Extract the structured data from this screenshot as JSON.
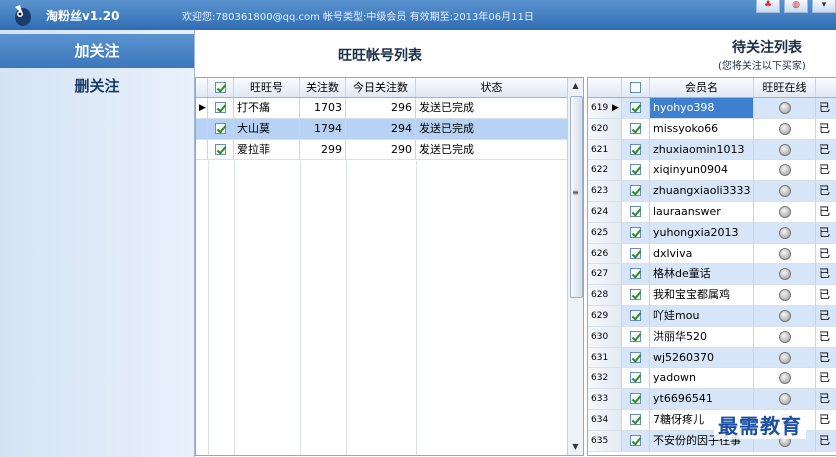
{
  "app": {
    "title": "淘粉丝v1.20",
    "welcome": "欢迎您:780361800@qq.com  帐号类型:中级会员  有效期至:2013年06月11日"
  },
  "sidebar": {
    "items": [
      {
        "label": "加关注",
        "active": true
      },
      {
        "label": "删关注",
        "active": false
      }
    ]
  },
  "left_panel": {
    "title": "旺旺帐号列表",
    "columns": [
      "旺旺号",
      "关注数",
      "今日关注数",
      "状态"
    ],
    "rows": [
      {
        "account": "打不痛",
        "follows": "1703",
        "today": "296",
        "status": "发送已完成",
        "checked": true,
        "current": true,
        "selected": false
      },
      {
        "account": "大山莫",
        "follows": "1794",
        "today": "294",
        "status": "发送已完成",
        "checked": true,
        "current": false,
        "selected": true
      },
      {
        "account": "爱拉菲",
        "follows": "299",
        "today": "290",
        "status": "发送已完成",
        "checked": true,
        "current": false,
        "selected": false
      }
    ]
  },
  "right_panel": {
    "title": "待关注列表",
    "subtitle": "(您将关注以下买家)",
    "columns": [
      "会员名",
      "旺旺在线"
    ],
    "status_text": "已",
    "rows": [
      {
        "num": "619",
        "name": "hyohyo398",
        "selected": true,
        "current": true
      },
      {
        "num": "620",
        "name": "missyoko66",
        "selected": false
      },
      {
        "num": "621",
        "name": "zhuxiaomin1013",
        "selected": true
      },
      {
        "num": "622",
        "name": "xiqinyun0904",
        "selected": false
      },
      {
        "num": "623",
        "name": "zhuangxiaoli3333",
        "selected": true
      },
      {
        "num": "624",
        "name": "lauraanswer",
        "selected": false
      },
      {
        "num": "625",
        "name": "yuhongxia2013",
        "selected": true
      },
      {
        "num": "626",
        "name": "dxlviva",
        "selected": false
      },
      {
        "num": "627",
        "name": "格林de童话",
        "selected": true
      },
      {
        "num": "628",
        "name": "我和宝宝都属鸡",
        "selected": false
      },
      {
        "num": "629",
        "name": "吖娃mou",
        "selected": true
      },
      {
        "num": "630",
        "name": "洪丽华520",
        "selected": false
      },
      {
        "num": "631",
        "name": "wj5260370",
        "selected": true
      },
      {
        "num": "632",
        "name": "yadown",
        "selected": false
      },
      {
        "num": "633",
        "name": "yt6696541",
        "selected": true
      },
      {
        "num": "634",
        "name": "7糖伢疼儿",
        "selected": false
      },
      {
        "num": "635",
        "name": "不安份的因子往事",
        "selected": true
      }
    ]
  },
  "watermark": "最需教育",
  "colors": {
    "titlebar": "#3b77bb",
    "selected_row": "#b7d2f4",
    "alt_row": "#d6e5f7"
  }
}
